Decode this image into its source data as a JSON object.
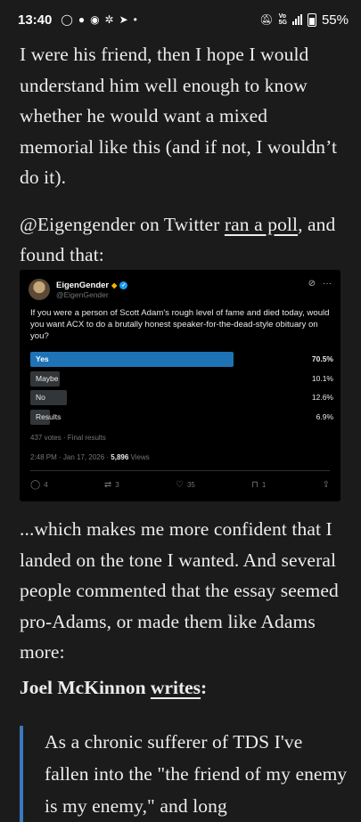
{
  "status_bar": {
    "time": "13:40",
    "left_icons": [
      "whatsapp-icon",
      "messenger-icon",
      "chat-icon",
      "settings-icon",
      "telegram-icon",
      "dot-icon"
    ],
    "volte_top": "Vo",
    "volte_bottom": "5G",
    "network": "5G",
    "battery": "55%"
  },
  "article": {
    "para1": "I were his friend, then I hope I would understand him well enough to know whether he would want a mixed memorial like this (and if not, I wouldn’t do it).",
    "para2_prefix": "@Eigengender on Twitter ",
    "para2_link": "ran a poll",
    "para2_suffix": ", and found that:",
    "para3": "...which makes me more confident that I landed on the tone I wanted. And several people commented that the essay seemed pro-Adams, or made them like Adams more:",
    "heading_name": "Joel McKinnon ",
    "heading_link": "writes",
    "heading_colon": ":",
    "quote": "As a chronic sufferer of TDS I've fallen into the \"the friend of my enemy is my enemy,\" and long"
  },
  "tweet": {
    "name": "EigenGender",
    "handle": "@EigenGender",
    "text": "If you were a person of Scott Adam's rough level of fame and died today, would you want ACX to do a brutally honest speaker-for-the-dead-style obituary on you?",
    "poll": [
      {
        "label": "Yes",
        "percent": "70.5%",
        "value": 70.5,
        "winner": true
      },
      {
        "label": "Maybe",
        "percent": "10.1%",
        "value": 10.1,
        "winner": false
      },
      {
        "label": "No",
        "percent": "12.6%",
        "value": 12.6,
        "winner": false
      },
      {
        "label": "Results",
        "percent": "6.9%",
        "value": 6.9,
        "winner": false
      }
    ],
    "votes": "437 votes · Final results",
    "date": "2:48 PM · Jan 17, 2026 · ",
    "views_count": "5,896",
    "views_label": " Views",
    "replies": "4",
    "reposts": "3",
    "likes": "35",
    "bookmarks": "1"
  },
  "colors": {
    "background": "#1b1b1b",
    "poll_winner": "#1d73b5",
    "quote_border": "#3a7ac0"
  }
}
